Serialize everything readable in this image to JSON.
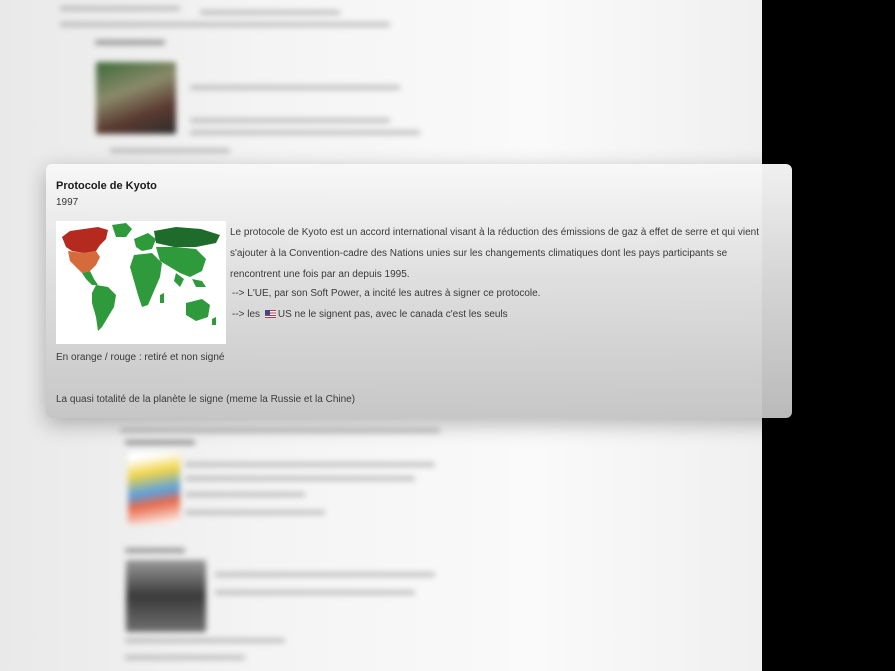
{
  "card": {
    "title": "Protocole de Kyoto",
    "year": "1997",
    "paragraph": "Le protocole de Kyoto est un accord international visant à la réduction des émissions de gaz à effet de serre et qui vient s'ajouter à la Convention-cadre des Nations unies sur les changements climatiques dont les pays participants se rencontrent une fois par an depuis 1995.",
    "bullet1": "--> L'UE, par son Soft Power, a incité les autres à signer ce protocole.",
    "bullet2_prefix": "--> les",
    "bullet2_suffix": "US ne le signent pas, avec le canada c'est les seuls",
    "legend_note": "En orange / rouge : retiré et non signé",
    "footer_note": "La quasi totalité de la planète le signe (meme la Russie et la Chine)"
  },
  "colors": {
    "signed_green": "#2f9a3c",
    "dark_green": "#1f6b2c",
    "withdrawn_red": "#b52a1e",
    "not_signed_orange": "#d56a3a",
    "side_black": "#000000"
  },
  "icons": {
    "flag": "us-flag-icon"
  }
}
